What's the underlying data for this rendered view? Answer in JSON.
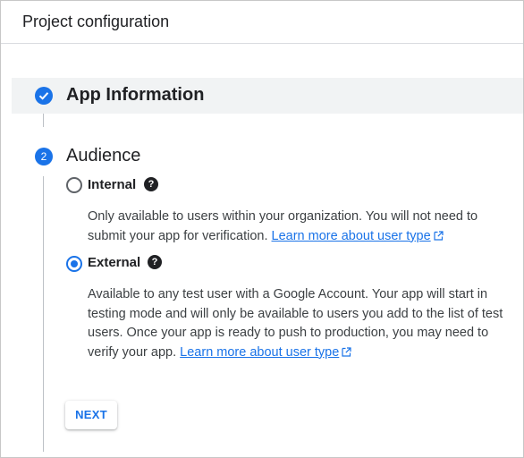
{
  "header": {
    "title": "Project configuration"
  },
  "steps": [
    {
      "number": "",
      "title": "App Information",
      "status": "completed",
      "icon": "check-icon"
    },
    {
      "number": "2",
      "title": "Audience",
      "status": "active"
    }
  ],
  "audience": {
    "options": [
      {
        "label": "Internal",
        "selected": false,
        "description": "Only available to users within your organization. You will not need to submit your app for verification.",
        "link_text": "Learn more about user type"
      },
      {
        "label": "External",
        "selected": true,
        "description": "Available to any test user with a Google Account. Your app will start in testing mode and will only be available to users you add to the list of test users. Once your app is ready to push to production, you may need to verify your app.",
        "link_text": "Learn more about user type"
      }
    ],
    "help_icon": "help-circle-icon",
    "link_icon": "open-in-new-icon"
  },
  "actions": {
    "next_label": "NEXT"
  },
  "colors": {
    "accent": "#1a73e8",
    "text": "#202124",
    "muted": "#3c4043",
    "band": "#f1f3f4"
  }
}
